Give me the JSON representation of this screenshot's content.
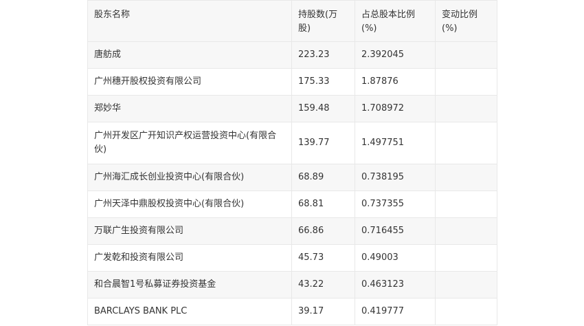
{
  "table": {
    "headers": [
      "股东名称",
      "持股数(万股)",
      "占总股本比例(%)",
      "变动比例(%)"
    ],
    "rows": [
      {
        "name": "唐舫成",
        "shares": "223.23",
        "ratio": "2.392045",
        "change": ""
      },
      {
        "name": "广州穗开股权投资有限公司",
        "shares": "175.33",
        "ratio": "1.87876",
        "change": ""
      },
      {
        "name": "郑妙华",
        "shares": "159.48",
        "ratio": "1.708972",
        "change": ""
      },
      {
        "name": "广州开发区广开知识产权运营投资中心(有限合伙)",
        "shares": "139.77",
        "ratio": "1.497751",
        "change": ""
      },
      {
        "name": "广州海汇成长创业投资中心(有限合伙)",
        "shares": "68.89",
        "ratio": "0.738195",
        "change": ""
      },
      {
        "name": "广州天泽中鼎股权投资中心(有限合伙)",
        "shares": "68.81",
        "ratio": "0.737355",
        "change": ""
      },
      {
        "name": "万联广生投资有限公司",
        "shares": "66.86",
        "ratio": "0.716455",
        "change": ""
      },
      {
        "name": "广发乾和投资有限公司",
        "shares": "45.73",
        "ratio": "0.49003",
        "change": ""
      },
      {
        "name": "和合晨智1号私募证券投资基金",
        "shares": "43.22",
        "ratio": "0.463123",
        "change": ""
      },
      {
        "name": "BARCLAYS BANK PLC",
        "shares": "39.17",
        "ratio": "0.419777",
        "change": ""
      }
    ]
  }
}
